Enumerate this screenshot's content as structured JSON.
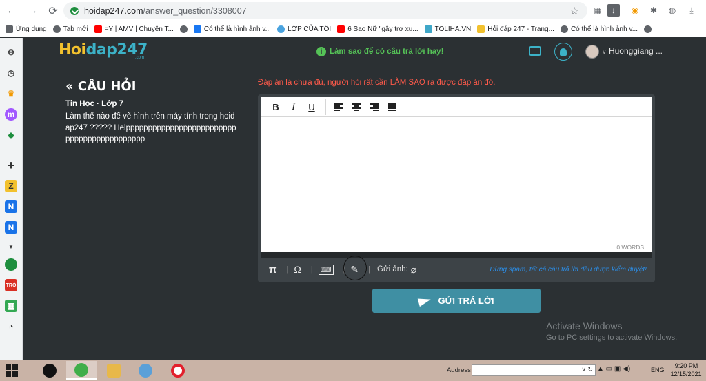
{
  "browser": {
    "url_host": "hoidap247.com",
    "url_path": "/answer_question/3308007",
    "bookmarks": [
      {
        "label": "Ứng dụng",
        "color": "#5f6368"
      },
      {
        "label": "Tab mới",
        "color": "#5f6368"
      },
      {
        "label": "=Y | AMV | Chuyện T...",
        "color": "#ff0000"
      },
      {
        "label": "Có thể là hình ảnh v...",
        "color": "#1877f2"
      },
      {
        "label": "LỚP CỦA TÔI",
        "color": "#4aa3df"
      },
      {
        "label": "6 Sao Nữ \"gây trơ xu...",
        "color": "#ff0000"
      },
      {
        "label": "TOLIHA.VN",
        "color": "#3fa7c8"
      },
      {
        "label": "Hỏi đáp 247 - Trang...",
        "color": "#f2c12e"
      },
      {
        "label": "Có thể là hình ảnh v...",
        "color": "#5f6368"
      }
    ]
  },
  "site": {
    "logo_part1": "Hoi",
    "logo_part2": "dap247",
    "logo_sub": ".com",
    "tip": "Làm sao để có câu trả lời hay!",
    "username": "Huonggiang ..."
  },
  "question": {
    "heading": "« CÂU HỎI",
    "meta": "Tin Học · Lớp 7",
    "body": "Làm thế nào để vẽ hình trên máy tính trong hoidap247 ????? Helppppppppppppppppppppppppppppppppppppppppppp"
  },
  "answer": {
    "notice": "Đáp án là chưa đủ, người hỏi rất cần LÀM SAO ra được đáp án đó.",
    "word_count": "0 WORDS",
    "send_image_label": "Gửi ảnh:",
    "spam_note": "Đừng spam, tất cả câu trả lời đều được kiểm duyệt!",
    "submit_label": "GỬI TRẢ LỜI"
  },
  "windows": {
    "activate_title": "Activate Windows",
    "activate_sub": "Go to PC settings to activate Windows.",
    "address_label": "Address",
    "lang": "ENG",
    "time": "9:20 PM",
    "date": "12/15/2021"
  },
  "colors": {
    "page_bg": "#2b3033",
    "accent": "#3f8fa3",
    "notice": "#ff5a4a",
    "tip": "#55c257",
    "spam": "#2b8ee8"
  }
}
